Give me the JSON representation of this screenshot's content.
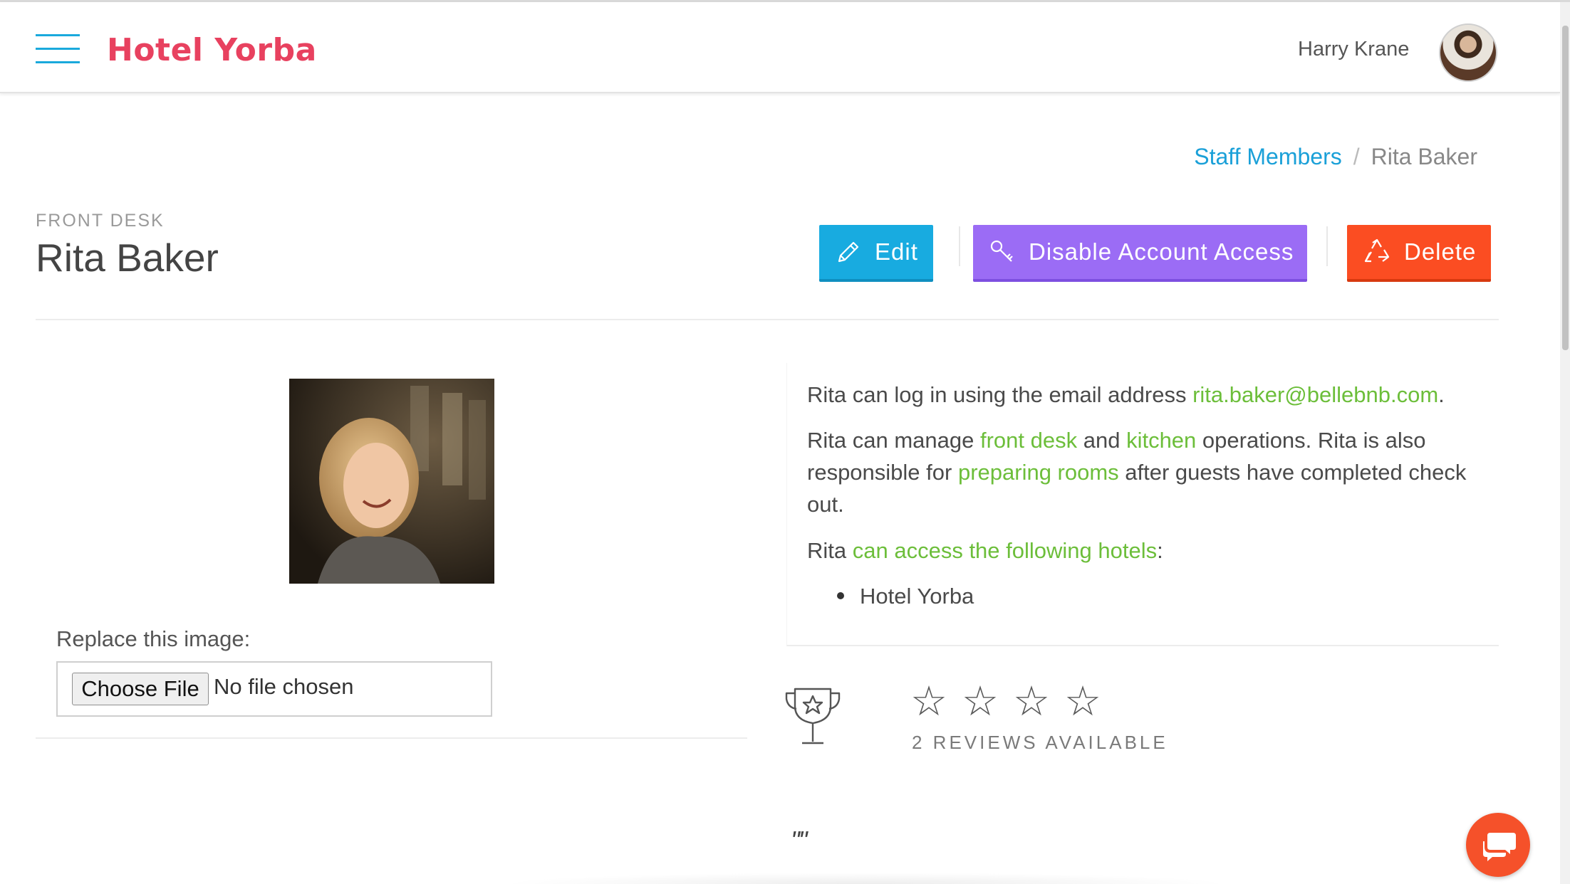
{
  "header": {
    "logo": "Hotel Yorba",
    "user_name": "Harry Krane"
  },
  "breadcrumb": {
    "parent": "Staff Members",
    "separator": "/",
    "current": "Rita Baker"
  },
  "profile": {
    "role": "FRONT DESK",
    "name": "Rita Baker"
  },
  "actions": {
    "edit_label": "Edit",
    "disable_label": "Disable Account Access",
    "delete_label": "Delete"
  },
  "upload": {
    "label": "Replace this image:",
    "button": "Choose File",
    "status": "No file chosen"
  },
  "info": {
    "login_prefix": "Rita can log in using the email address ",
    "email": "rita.baker@bellebnb.com",
    "login_suffix": ".",
    "manage_prefix": "Rita can manage ",
    "manage_link1": "front desk",
    "manage_and": " and ",
    "manage_link2": "kitchen",
    "manage_mid": " operations. Rita is also responsible for ",
    "manage_link3": "preparing rooms",
    "manage_suffix": " after guests have completed check out.",
    "hotels_prefix": "Rita ",
    "hotels_link": "can access the following hotels",
    "hotels_suffix": ":",
    "hotels": [
      "Hotel Yorba"
    ]
  },
  "reviews": {
    "stars": [
      "☆",
      "☆",
      "☆",
      "☆"
    ],
    "count_text": "2 REVIEWS AVAILABLE",
    "quote": "\"\""
  },
  "colors": {
    "brand": "#e8415f",
    "link_blue": "#1aa0d8",
    "link_green": "#6cbe3a",
    "edit": "#18abe0",
    "disable": "#9b6cf5",
    "delete": "#fb4d22"
  }
}
